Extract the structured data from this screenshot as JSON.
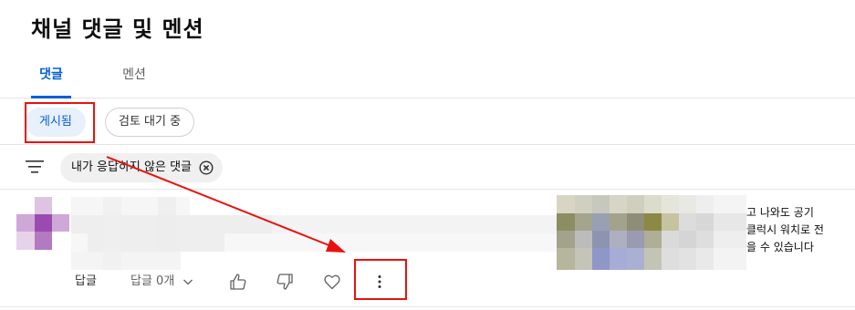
{
  "page": {
    "title": "채널 댓글 및 멘션"
  },
  "tabs": [
    {
      "label": "댓글",
      "selected": true
    },
    {
      "label": "멘션",
      "selected": false
    }
  ],
  "status_chips": [
    {
      "label": "게시됨",
      "selected": true
    },
    {
      "label": "검토 대기 중",
      "selected": false
    }
  ],
  "filter": {
    "chip_label": "내가 응답하지 않은 댓글",
    "icon": "filter-lines-icon"
  },
  "comment": {
    "video_description_lines": [
      "고 나와도 공기",
      "클럭시 워치로 전",
      "을 수 있습니다"
    ],
    "reply_label": "답글",
    "replies_toggle_label": "답글 0개"
  },
  "icons": [
    "filter-icon",
    "close-circle-icon",
    "chevron-down-icon",
    "thumb-up-icon",
    "thumb-down-icon",
    "heart-icon",
    "more-vert-icon"
  ],
  "colors": {
    "accent": "#065fd4",
    "annotation": "#e8120c",
    "chip_selected_bg": "#e8f0fb"
  }
}
